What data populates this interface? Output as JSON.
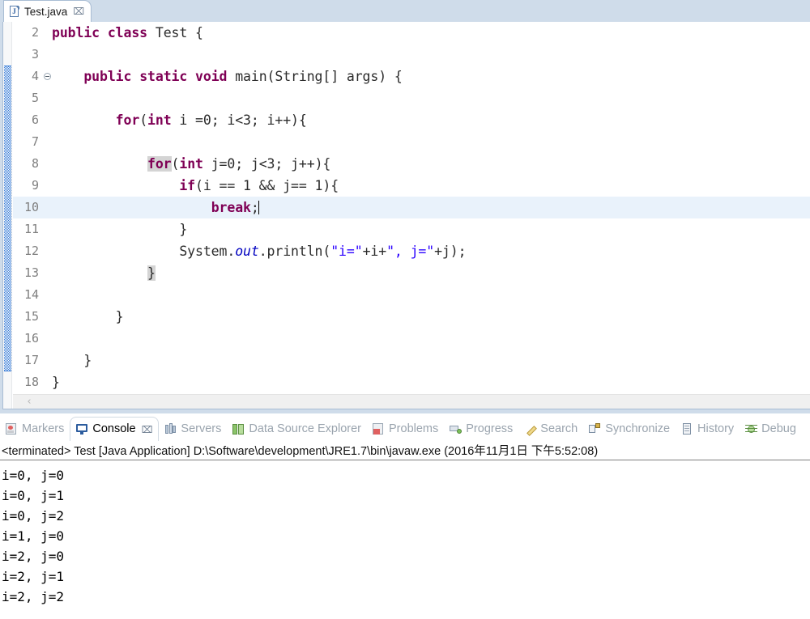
{
  "editor": {
    "tab": {
      "label": "Test.java",
      "icon": "java-file-icon",
      "close_label": "⌧"
    },
    "scrollbar": {
      "left_arrow": "‹"
    },
    "lines": [
      {
        "no": "2",
        "indent": 0,
        "fold": false,
        "current": false,
        "tokens": [
          {
            "t": "public ",
            "c": "kw"
          },
          {
            "t": "class ",
            "c": "kw"
          },
          {
            "t": "Test {",
            "c": "plain"
          }
        ]
      },
      {
        "no": "3",
        "indent": 0,
        "fold": false,
        "current": false,
        "tokens": []
      },
      {
        "no": "4",
        "indent": 0,
        "fold": true,
        "current": false,
        "tokens": [
          {
            "t": "    ",
            "c": "plain"
          },
          {
            "t": "public ",
            "c": "kw"
          },
          {
            "t": "static ",
            "c": "kw"
          },
          {
            "t": "void ",
            "c": "kw"
          },
          {
            "t": "main(String[] args) {",
            "c": "plain"
          }
        ]
      },
      {
        "no": "5",
        "indent": 0,
        "fold": false,
        "current": false,
        "tokens": []
      },
      {
        "no": "6",
        "indent": 0,
        "fold": false,
        "current": false,
        "tokens": [
          {
            "t": "        ",
            "c": "plain"
          },
          {
            "t": "for",
            "c": "kw"
          },
          {
            "t": "(",
            "c": "plain"
          },
          {
            "t": "int",
            "c": "kw"
          },
          {
            "t": " i =0; i<3; i++){",
            "c": "plain"
          }
        ]
      },
      {
        "no": "7",
        "indent": 0,
        "fold": false,
        "current": false,
        "tokens": []
      },
      {
        "no": "8",
        "indent": 0,
        "fold": false,
        "current": false,
        "tokens": [
          {
            "t": "            ",
            "c": "plain"
          },
          {
            "t": "for",
            "c": "kw occ"
          },
          {
            "t": "(",
            "c": "plain"
          },
          {
            "t": "int",
            "c": "kw"
          },
          {
            "t": " j=0; j<3; j++){",
            "c": "plain"
          }
        ]
      },
      {
        "no": "9",
        "indent": 0,
        "fold": false,
        "current": false,
        "tokens": [
          {
            "t": "                ",
            "c": "plain"
          },
          {
            "t": "if",
            "c": "kw"
          },
          {
            "t": "(i == 1 && j== 1){",
            "c": "plain"
          }
        ]
      },
      {
        "no": "10",
        "indent": 0,
        "fold": false,
        "current": true,
        "tokens": [
          {
            "t": "                    ",
            "c": "plain"
          },
          {
            "t": "break",
            "c": "kw"
          },
          {
            "t": ";",
            "c": "plain"
          }
        ],
        "caret": true
      },
      {
        "no": "11",
        "indent": 0,
        "fold": false,
        "current": false,
        "tokens": [
          {
            "t": "                }",
            "c": "plain"
          }
        ]
      },
      {
        "no": "12",
        "indent": 0,
        "fold": false,
        "current": false,
        "tokens": [
          {
            "t": "                System.",
            "c": "plain"
          },
          {
            "t": "out",
            "c": "fld"
          },
          {
            "t": ".println(",
            "c": "plain"
          },
          {
            "t": "\"i=\"",
            "c": "str"
          },
          {
            "t": "+i+",
            "c": "plain"
          },
          {
            "t": "\", j=\"",
            "c": "str"
          },
          {
            "t": "+j);",
            "c": "plain"
          }
        ]
      },
      {
        "no": "13",
        "indent": 0,
        "fold": false,
        "current": false,
        "tokens": [
          {
            "t": "            ",
            "c": "plain"
          },
          {
            "t": "}",
            "c": "brk"
          }
        ]
      },
      {
        "no": "14",
        "indent": 0,
        "fold": false,
        "current": false,
        "tokens": []
      },
      {
        "no": "15",
        "indent": 0,
        "fold": false,
        "current": false,
        "tokens": [
          {
            "t": "        }",
            "c": "plain"
          }
        ]
      },
      {
        "no": "16",
        "indent": 0,
        "fold": false,
        "current": false,
        "tokens": []
      },
      {
        "no": "17",
        "indent": 0,
        "fold": false,
        "current": false,
        "tokens": [
          {
            "t": "    }",
            "c": "plain"
          }
        ]
      },
      {
        "no": "18",
        "indent": 0,
        "fold": false,
        "current": false,
        "tokens": [
          {
            "t": "}",
            "c": "plain"
          }
        ]
      }
    ]
  },
  "console": {
    "tabs": [
      {
        "label": "Markers",
        "icon": "markers-icon",
        "active": false,
        "closeable": false
      },
      {
        "label": "Console",
        "icon": "console-icon",
        "active": true,
        "closeable": true
      },
      {
        "label": "Servers",
        "icon": "servers-icon",
        "active": false,
        "closeable": false
      },
      {
        "label": "Data Source Explorer",
        "icon": "data-source-explorer-icon",
        "active": false,
        "closeable": false
      },
      {
        "label": "Problems",
        "icon": "problems-icon",
        "active": false,
        "closeable": false
      },
      {
        "label": "Progress",
        "icon": "progress-icon",
        "active": false,
        "closeable": false
      },
      {
        "label": "Search",
        "icon": "search-icon",
        "active": false,
        "closeable": false
      },
      {
        "label": "Synchronize",
        "icon": "synchronize-icon",
        "active": false,
        "closeable": false
      },
      {
        "label": "History",
        "icon": "history-icon",
        "active": false,
        "closeable": false
      },
      {
        "label": "Debug",
        "icon": "debug-icon",
        "active": false,
        "closeable": false
      }
    ],
    "close_label": "⌧",
    "status": "<terminated> Test [Java Application] D:\\Software\\development\\JRE1.7\\bin\\javaw.exe (2016年11月1日 下午5:52:08)",
    "output": [
      "i=0, j=0",
      "i=0, j=1",
      "i=0, j=2",
      "i=1, j=0",
      "i=2, j=0",
      "i=2, j=1",
      "i=2, j=2"
    ]
  },
  "colors": {
    "keyword": "#7f0055",
    "string": "#2a00ff",
    "field": "#0000c0",
    "current_line": "#e9f2fb",
    "occurrence": "#d4d4d4",
    "change_bar": "#3c7fd8",
    "tab_bar": "#cfdcea"
  }
}
